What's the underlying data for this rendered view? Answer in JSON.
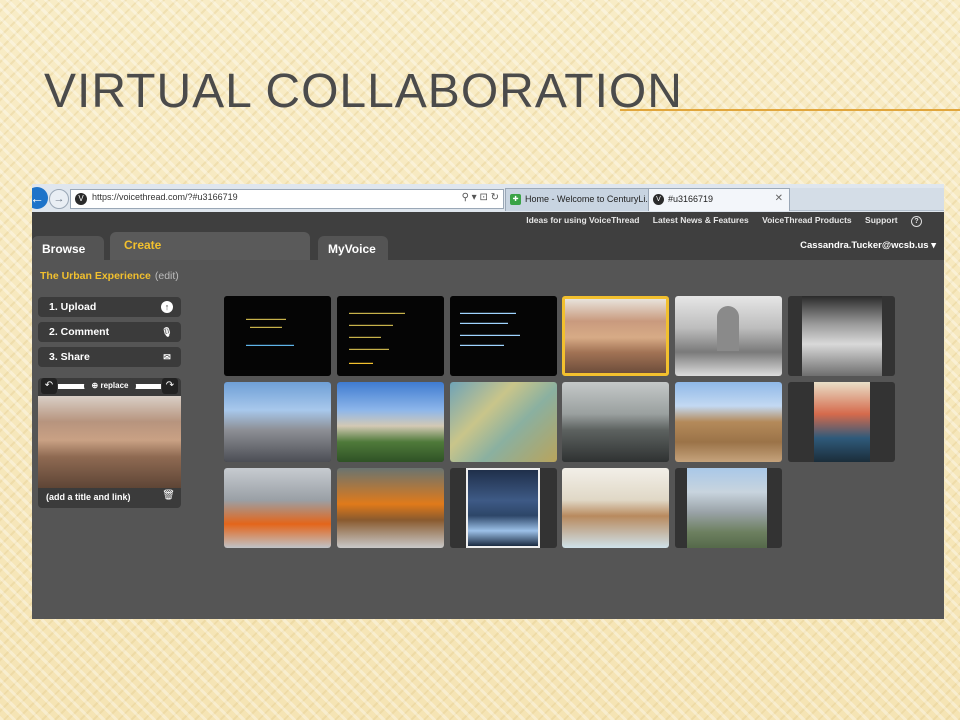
{
  "slide": {
    "title": "Virtual Collaboration"
  },
  "browser": {
    "url": "https://voicethread.com/?#u3166719",
    "tabs": [
      {
        "label": "Home - Welcome to CenturyLi...",
        "active": false
      },
      {
        "label": "#u3166719",
        "active": true,
        "close": "✕"
      }
    ]
  },
  "voicethread": {
    "top_links": [
      "Ideas for using VoiceThread",
      "Latest News & Features",
      "VoiceThread Products",
      "Support"
    ],
    "nav_tabs": [
      {
        "label": "Browse"
      },
      {
        "label": "Create",
        "active": true
      },
      {
        "label": "MyVoice"
      }
    ],
    "user": "Cassandra.Tucker@wcsb.us",
    "project_title": "The Urban Experience",
    "edit_label": "(edit)",
    "steps": [
      {
        "label": "1. Upload",
        "icon": "upload-icon"
      },
      {
        "label": "2. Comment",
        "icon": "microphone-icon"
      },
      {
        "label": "3. Share",
        "icon": "envelope-icon"
      }
    ],
    "replace_label": "replace",
    "caption_placeholder": "(add a title and link)",
    "thumbnails": [
      {
        "kind": "text-slide",
        "selected": false
      },
      {
        "kind": "text-slide",
        "selected": false
      },
      {
        "kind": "text-slide",
        "selected": false
      },
      {
        "kind": "desert-photo",
        "selected": true
      },
      {
        "kind": "bw-cathedral",
        "selected": false
      },
      {
        "kind": "bw-plaza",
        "selected": false
      },
      {
        "kind": "skyline",
        "selected": false
      },
      {
        "kind": "hilltop-ruins",
        "selected": false
      },
      {
        "kind": "impressionist-station",
        "selected": false
      },
      {
        "kind": "rainy-street-painting",
        "selected": false
      },
      {
        "kind": "mud-mosque",
        "selected": false
      },
      {
        "kind": "woodblock-print",
        "selected": false
      },
      {
        "kind": "park-installation",
        "selected": false
      },
      {
        "kind": "orange-gates",
        "selected": false
      },
      {
        "kind": "bridge-night",
        "selected": false
      },
      {
        "kind": "bridge-watercolor",
        "selected": false
      },
      {
        "kind": "paris-tower",
        "selected": false
      }
    ]
  }
}
